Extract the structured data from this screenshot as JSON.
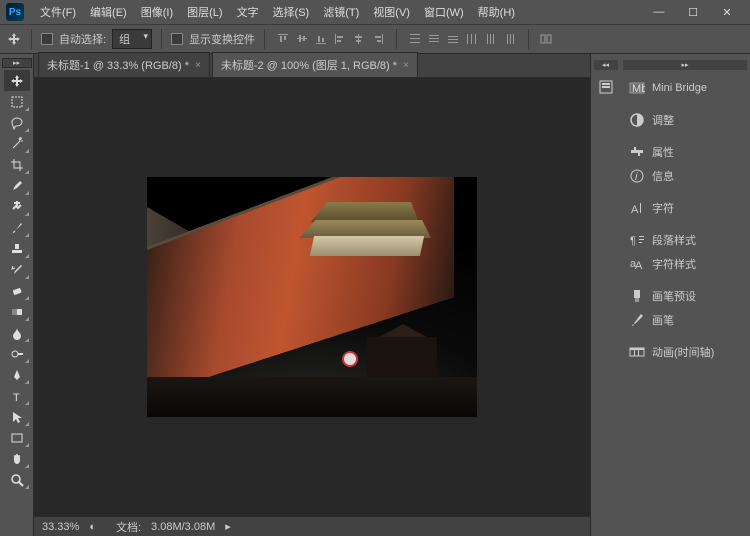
{
  "logo_text": "Ps",
  "menu": [
    "文件(F)",
    "编辑(E)",
    "图像(I)",
    "图层(L)",
    "文字",
    "选择(S)",
    "滤镜(T)",
    "视图(V)",
    "窗口(W)",
    "帮助(H)"
  ],
  "win": {
    "min": "—",
    "max": "☐",
    "close": "✕"
  },
  "options": {
    "auto_select": "自动选择:",
    "group": "组",
    "show_transform": "显示变换控件"
  },
  "tabs": [
    {
      "label": "未标题-1 @ 33.3% (RGB/8) *",
      "active": true
    },
    {
      "label": "未标题-2 @ 100% (图层 1, RGB/8) *",
      "active": false
    }
  ],
  "status": {
    "zoom": "33.33%",
    "doc_label": "文档:",
    "doc_size": "3.08M/3.08M"
  },
  "panels": [
    {
      "icon": "mb",
      "label": "Mini Bridge"
    },
    null,
    {
      "icon": "adjust",
      "label": "调整"
    },
    null,
    {
      "icon": "props",
      "label": "属性"
    },
    {
      "icon": "info",
      "label": "信息"
    },
    null,
    {
      "icon": "char",
      "label": "字符"
    },
    null,
    {
      "icon": "para",
      "label": "段落样式"
    },
    {
      "icon": "cstyle",
      "label": "字符样式"
    },
    null,
    {
      "icon": "preset",
      "label": "画笔预设"
    },
    {
      "icon": "brush",
      "label": "画笔"
    },
    null,
    {
      "icon": "timeline",
      "label": "动画(时间轴)"
    }
  ]
}
